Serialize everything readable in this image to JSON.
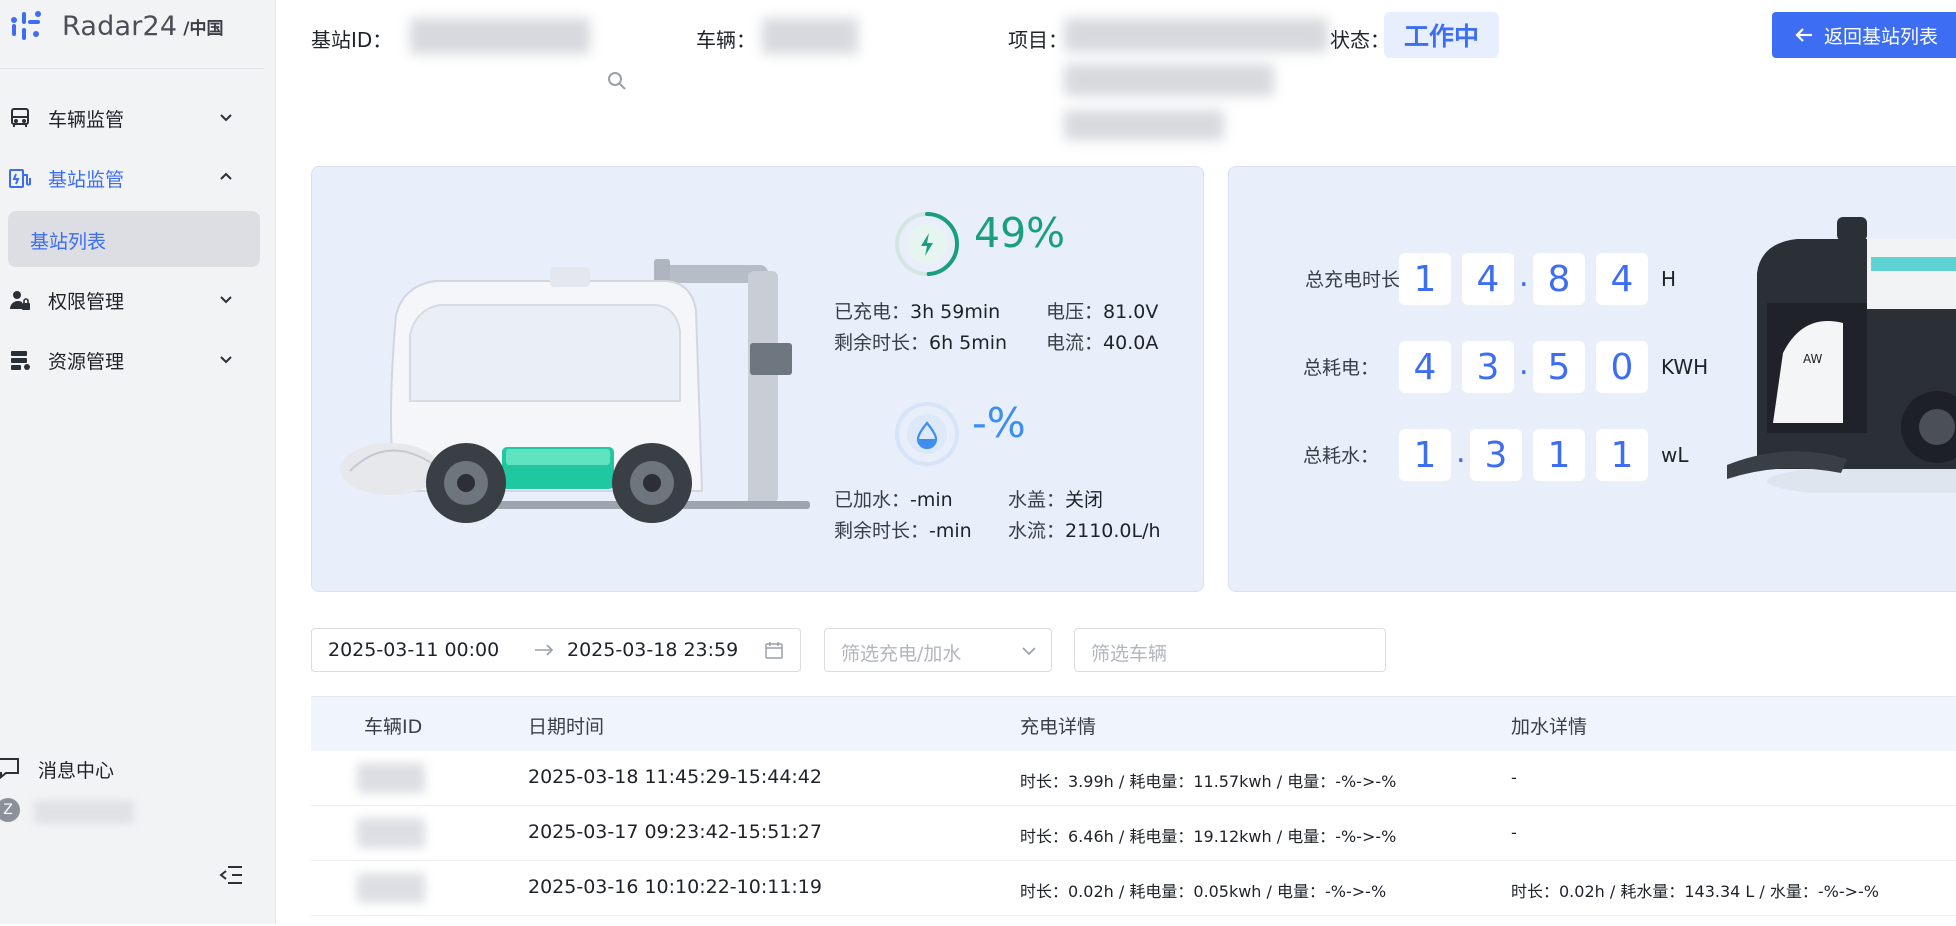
{
  "brand": {
    "name": "Radar24",
    "region": "/中国",
    "accent": "#3d6df2"
  },
  "sidebar": {
    "items": [
      {
        "label": "车辆监管",
        "icon": "bus-icon",
        "expanded": false
      },
      {
        "label": "基站监管",
        "icon": "station-icon",
        "expanded": true,
        "active": true
      },
      {
        "label": "权限管理",
        "icon": "user-lock-icon",
        "expanded": false
      },
      {
        "label": "资源管理",
        "icon": "server-icon",
        "expanded": false
      }
    ],
    "subitem": {
      "label": "基站列表"
    },
    "message_center": "消息中心",
    "user_initial": "Z"
  },
  "header": {
    "station_id_label": "基站ID：",
    "vehicle_label": "车辆：",
    "project_label": "项目：",
    "status_label": "状态：",
    "status_value": "工作中",
    "back_button": "返回基站列表"
  },
  "charging": {
    "percent": "49%",
    "percent_value": 49,
    "charged_label": "已充电：",
    "charged_value": "3h 59min",
    "voltage_label": "电压：",
    "voltage_value": "81.0V",
    "remaining_label": "剩余时长：",
    "remaining_value": "6h 5min",
    "current_label": "电流：",
    "current_value": "40.0A"
  },
  "water": {
    "percent": "-%",
    "added_label": "已加水：",
    "added_value": "-min",
    "cover_label": "水盖：",
    "cover_value": "关闭",
    "remaining_label": "剩余时长：",
    "remaining_value": "-min",
    "flow_label": "水流：",
    "flow_value": "2110.0L/h"
  },
  "totals": {
    "charge_time": {
      "label": "总充电时长：",
      "d1": "1",
      "d2": "4",
      "dot": ".",
      "d3": "8",
      "d4": "4",
      "unit": "H"
    },
    "power": {
      "label": "总耗电：",
      "d1": "4",
      "d2": "3",
      "dot": ".",
      "d3": "5",
      "d4": "0",
      "unit": "KWH"
    },
    "water": {
      "label": "总耗水：",
      "d1": "1",
      "dot": ".",
      "d2": "3",
      "d3": "1",
      "d4": "1",
      "unit": "wL"
    }
  },
  "filters": {
    "date_start": "2025-03-11 00:00",
    "date_end": "2025-03-18 23:59",
    "type_placeholder": "筛选充电/加水",
    "vehicle_placeholder": "筛选车辆"
  },
  "table": {
    "headers": {
      "vehicle_id": "车辆ID",
      "datetime": "日期时间",
      "charge": "充电详情",
      "water": "加水详情"
    },
    "rows": [
      {
        "datetime": "2025-03-18 11:45:29-15:44:42",
        "charge": "时长：3.99h / 耗电量：11.57kwh / 电量：-%->-%",
        "water": "-"
      },
      {
        "datetime": "2025-03-17 09:23:42-15:51:27",
        "charge": "时长：6.46h / 耗电量：19.12kwh / 电量：-%->-%",
        "water": "-"
      },
      {
        "datetime": "2025-03-16 10:10:22-10:11:19",
        "charge": "时长：0.02h / 耗电量：0.05kwh / 电量：-%->-%",
        "water": "时长：0.02h / 耗水量：143.34 L / 水量：-%->-%"
      }
    ]
  }
}
